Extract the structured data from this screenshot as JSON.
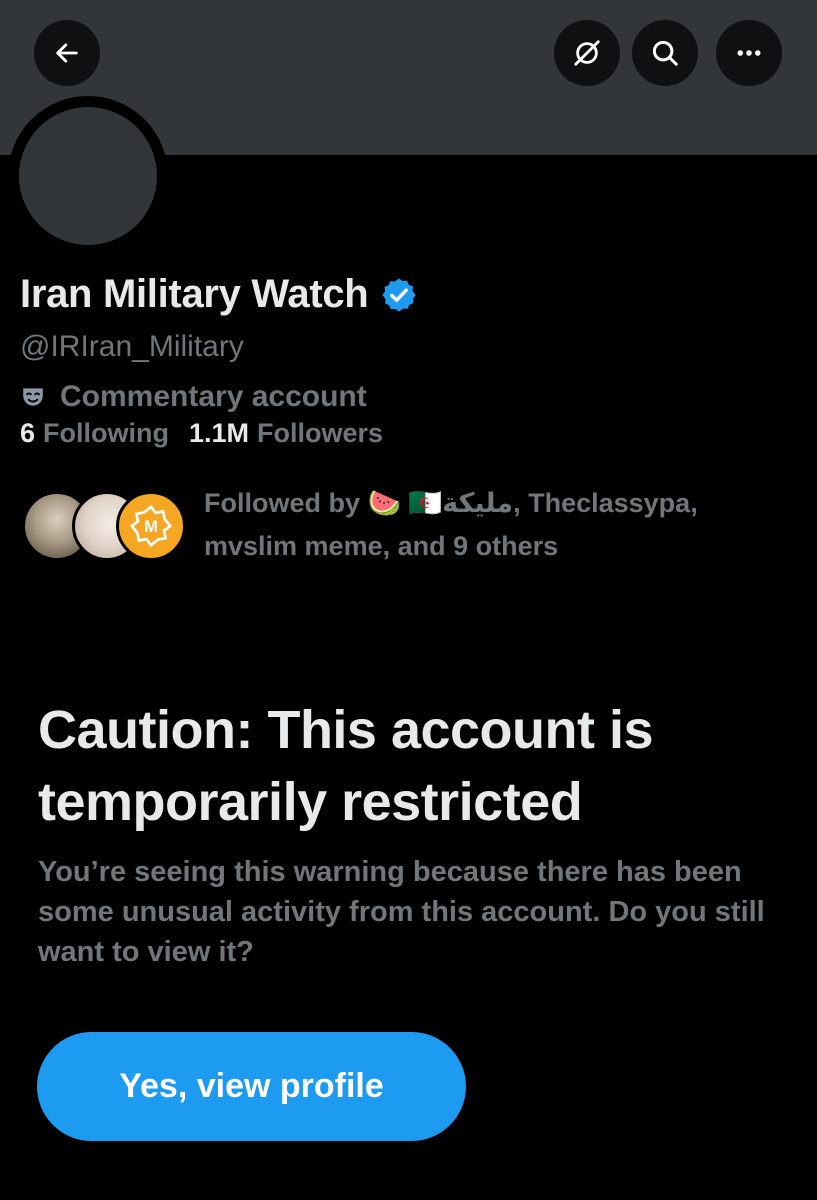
{
  "header": {
    "back_icon": "arrow-left-icon",
    "grok_icon": "grok-icon",
    "search_icon": "search-icon",
    "more_icon": "more-horizontal-icon"
  },
  "profile": {
    "name": "Iran Military Watch",
    "verified": true,
    "handle": "@IRIran_Military",
    "label_icon": "theater-mask-icon",
    "label": "Commentary account",
    "following_count": "6",
    "following_label": "Following",
    "followers_count": "1.1M",
    "followers_label": "Followers"
  },
  "followed_by": {
    "text": "Followed by 🍉 🇩🇿مليكة, Theclassypa, mvslim meme, and 9 others",
    "avatars": [
      "follower-avatar-1",
      "follower-avatar-2",
      "follower-avatar-3"
    ],
    "badge_text": "M"
  },
  "warning": {
    "title": "Caution: This account is temporarily restricted",
    "body": "You’re seeing this warning because there has been some unusual activity from this account. Do you still want to view it?",
    "button_label": "Yes, view profile"
  },
  "colors": {
    "background": "#000000",
    "banner": "#333639",
    "text_primary": "#e7e9ea",
    "text_secondary": "#71767b",
    "accent": "#1d9bf0"
  }
}
